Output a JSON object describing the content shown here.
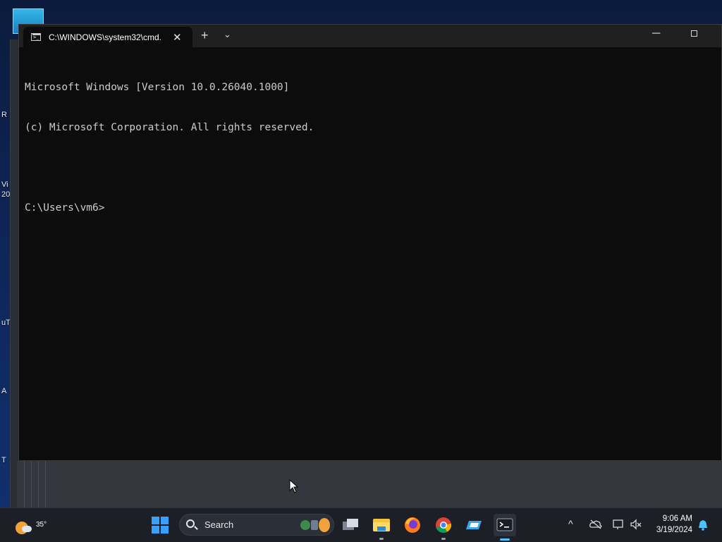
{
  "desktop": {
    "icon_labels": [
      "R",
      "Vi",
      "20",
      "uT",
      "A",
      "T"
    ]
  },
  "terminal": {
    "tab_title": "C:\\WINDOWS\\system32\\cmd.",
    "new_tab_glyph": "+",
    "dropdown_glyph": "⌄",
    "close_glyph": "✕",
    "minimize_glyph": "─",
    "lines": [
      "Microsoft Windows [Version 10.0.26040.1000]",
      "(c) Microsoft Corporation. All rights reserved.",
      "",
      "C:\\Users\\vm6>"
    ]
  },
  "taskbar": {
    "weather_temp": "35°",
    "search_placeholder": "Search",
    "apps": [
      "task-view",
      "file-explorer",
      "firefox",
      "chrome",
      "settings-app",
      "terminal"
    ],
    "tray_chevron": "^",
    "time": "9:06 AM",
    "date": "3/19/2024"
  },
  "colors": {
    "accent": "#4cc2ff",
    "terminal_bg": "#0c0c0c",
    "titlebar_bg": "#202020",
    "taskbar_bg": "#1c1f26"
  }
}
